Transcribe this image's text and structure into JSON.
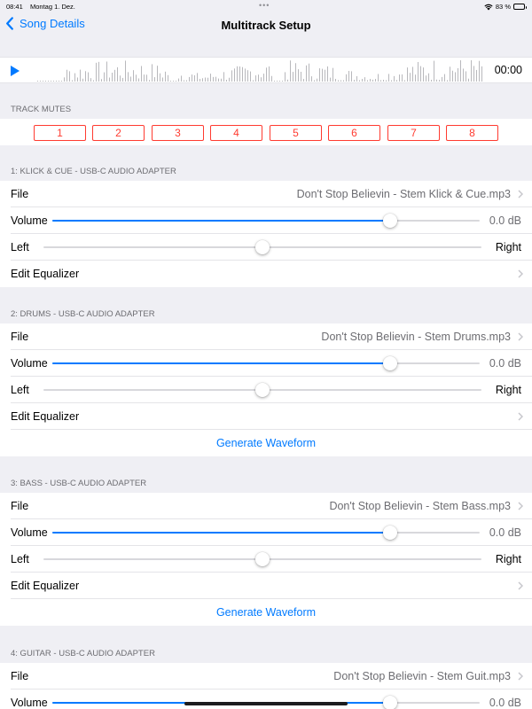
{
  "status_bar": {
    "time": "08:41",
    "date": "Montag 1. Dez.",
    "dots": "•••",
    "battery": "83 %",
    "battery_level": 0.83
  },
  "nav": {
    "back_label": "Song Details",
    "title": "Multitrack Setup"
  },
  "player": {
    "time": "00:00",
    "accent": "#007aff"
  },
  "mutes": {
    "header": "TRACK MUTES",
    "buttons": [
      "1",
      "2",
      "3",
      "4",
      "5",
      "6",
      "7",
      "8"
    ],
    "color": "#ff3b30"
  },
  "tracks": [
    {
      "header": "1: KLICK & CUE - USB-C AUDIO ADAPTER",
      "file_label": "File",
      "file_value": "Don't Stop Believin - Stem Klick & Cue.mp3",
      "volume_label": "Volume",
      "volume_value": "0.0 dB",
      "volume_level": 0.79,
      "left_label": "Left",
      "right_label": "Right",
      "pan_level": 0.5,
      "eq_label": "Edit Equalizer"
    },
    {
      "header": "2: DRUMS - USB-C AUDIO ADAPTER",
      "file_label": "File",
      "file_value": "Don't Stop Believin - Stem Drums.mp3",
      "volume_label": "Volume",
      "volume_value": "0.0 dB",
      "volume_level": 0.79,
      "left_label": "Left",
      "right_label": "Right",
      "pan_level": 0.5,
      "eq_label": "Edit Equalizer",
      "waveform_label": "Generate Waveform"
    },
    {
      "header": "3: BASS - USB-C AUDIO ADAPTER",
      "file_label": "File",
      "file_value": "Don't Stop Believin - Stem Bass.mp3",
      "volume_label": "Volume",
      "volume_value": "0.0 dB",
      "volume_level": 0.79,
      "left_label": "Left",
      "right_label": "Right",
      "pan_level": 0.5,
      "eq_label": "Edit Equalizer",
      "waveform_label": "Generate Waveform"
    },
    {
      "header": "4: GUITAR - USB-C AUDIO ADAPTER",
      "file_label": "File",
      "file_value": "Don't Stop Believin - Stem Guit.mp3",
      "volume_label": "Volume",
      "volume_value": "0.0 dB",
      "volume_level": 0.79
    }
  ]
}
